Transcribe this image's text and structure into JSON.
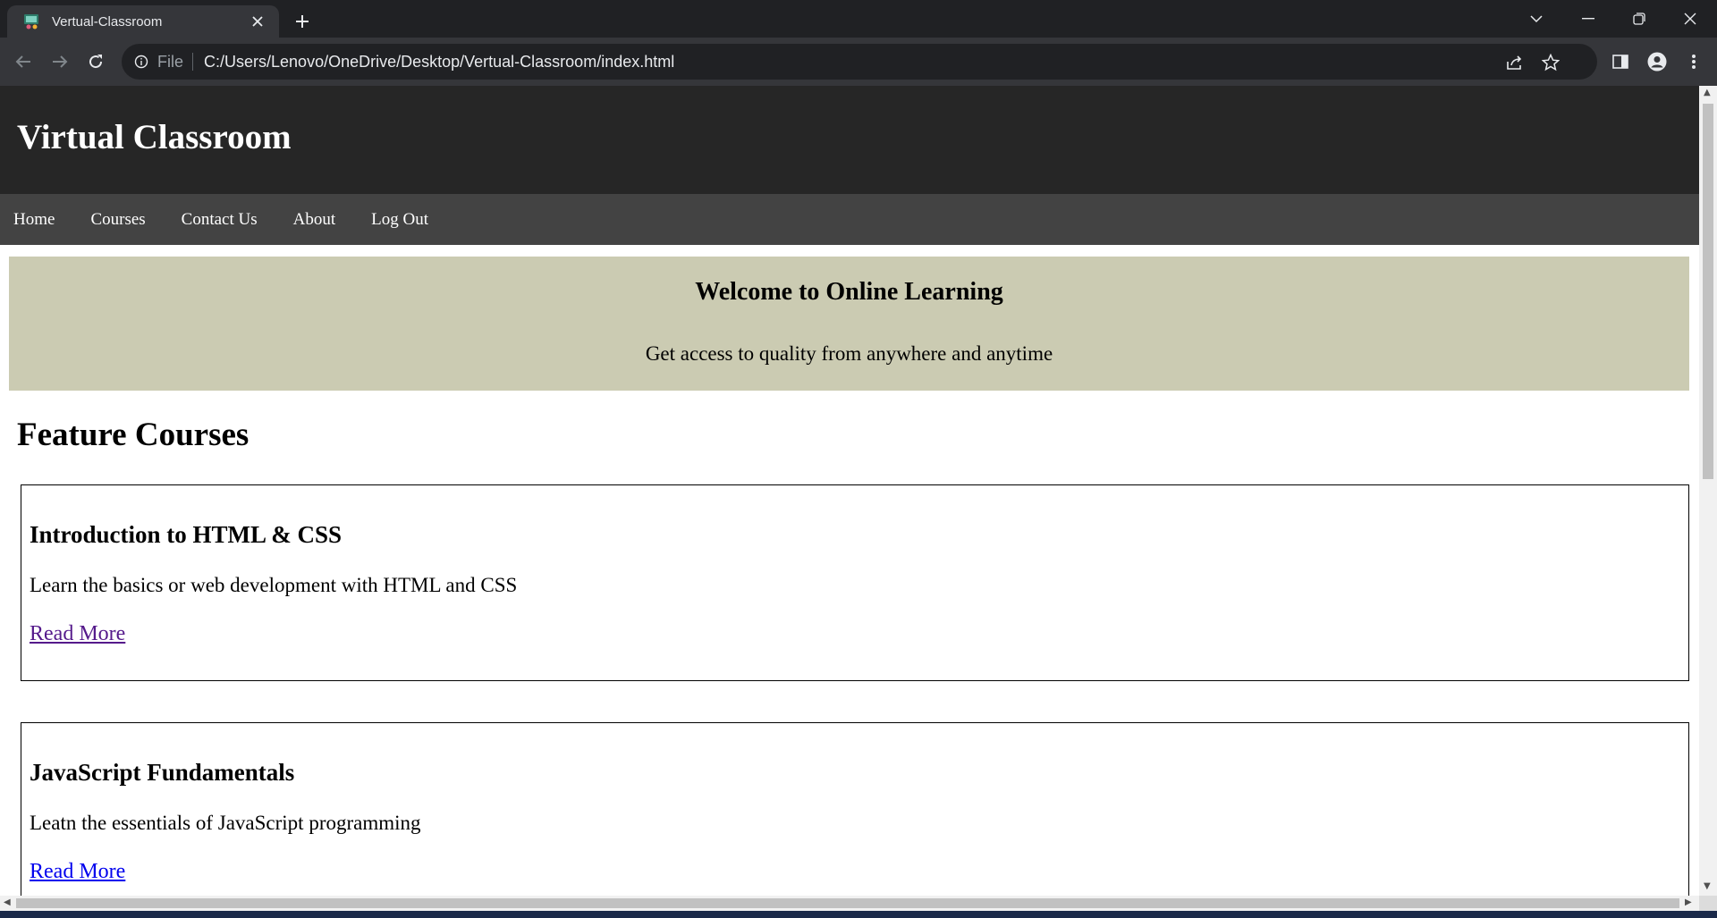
{
  "browser": {
    "tab_title": "Vertual-Classroom",
    "url_scheme": "File",
    "url": "C:/Users/Lenovo/OneDrive/Desktop/Vertual-Classroom/index.html"
  },
  "site": {
    "title": "Virtual Classroom",
    "nav": [
      "Home",
      "Courses",
      "Contact Us",
      "About",
      "Log Out"
    ]
  },
  "banner": {
    "title": "Welcome to Online Learning",
    "subtitle": "Get access to quality from anywhere and anytime"
  },
  "featured": {
    "heading": "Feature Courses",
    "courses": [
      {
        "title": "Introduction to HTML & CSS",
        "description": "Learn the basics or web development with HTML and CSS",
        "link": "Read More"
      },
      {
        "title": "JavaScript Fundamentals",
        "description": "Leatn the essentials of JavaScript programming",
        "link": "Read More"
      }
    ]
  },
  "colors": {
    "header_bg": "#262626",
    "nav_bg": "#434343",
    "banner_bg": "#cbcbb2",
    "visited_link": "#551a8b",
    "link": "#0000ee"
  }
}
